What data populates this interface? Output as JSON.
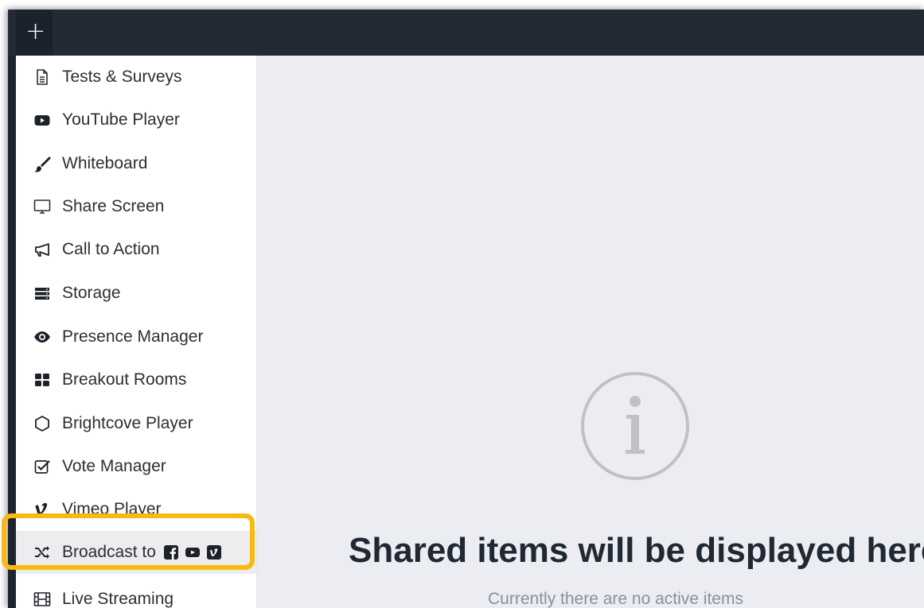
{
  "topbar": {
    "add_label": "+"
  },
  "sidebar": {
    "items": [
      {
        "label": "Tests & Surveys",
        "icon": "document-icon"
      },
      {
        "label": "YouTube Player",
        "icon": "youtube-icon"
      },
      {
        "label": "Whiteboard",
        "icon": "brush-icon"
      },
      {
        "label": " Share Screen",
        "icon": "monitor-icon"
      },
      {
        "label": "Call to Action",
        "icon": "megaphone-icon"
      },
      {
        "label": "Storage",
        "icon": "server-icon"
      },
      {
        "label": "Presence Manager",
        "icon": "eye-icon"
      },
      {
        "label": "Breakout Rooms",
        "icon": "grid-icon"
      },
      {
        "label": "Brightcove Player",
        "icon": "brightcove-icon"
      },
      {
        "label": "Vote Manager",
        "icon": "checkbox-icon"
      },
      {
        "label": "Vimeo Player",
        "icon": "vimeo-icon"
      },
      {
        "label": "Broadcast to",
        "icon": "shuffle-icon",
        "brand_icons": [
          "facebook-icon",
          "youtube-icon",
          "vimeo-icon"
        ]
      },
      {
        "label": "Live Streaming",
        "icon": "film-icon"
      }
    ]
  },
  "main": {
    "empty_title": "Shared items will be displayed here",
    "empty_subtitle": "Currently there are no active items",
    "icon": "info-circle-icon"
  },
  "colors": {
    "topbar": "#232a36",
    "main_bg": "#ebedf2",
    "highlight": "#f8b912"
  }
}
